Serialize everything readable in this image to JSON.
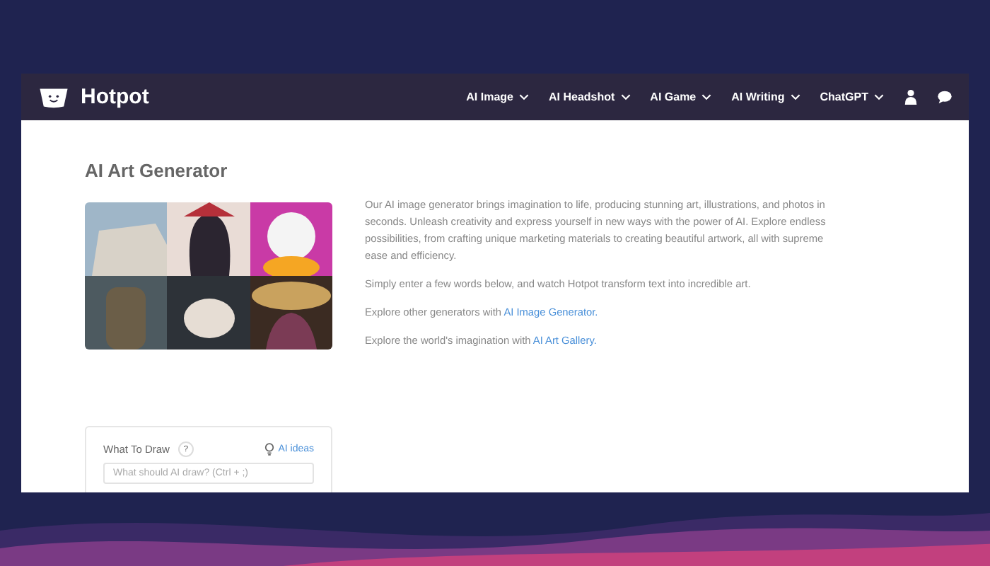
{
  "header": {
    "brand": "Hotpot",
    "nav": [
      {
        "label": "AI Image"
      },
      {
        "label": "AI Headshot"
      },
      {
        "label": "AI Game"
      },
      {
        "label": "AI Writing"
      },
      {
        "label": "ChatGPT"
      }
    ]
  },
  "page": {
    "title": "AI Art Generator",
    "intro": "Our AI image generator brings imagination to life, producing stunning art, illustrations, and photos in seconds. Unleash creativity and express yourself in new ways with the power of AI. Explore endless possibilities, from crafting unique marketing materials to creating beautiful artwork, all with supreme ease and efficiency.",
    "paragraphs": [
      {
        "text": "Simply enter a few words below, and watch Hotpot transform text into incredible art."
      },
      {
        "text": "Explore other generators with ",
        "link": "AI Image Generator."
      },
      {
        "text": "Explore the world's imagination with ",
        "link": "AI Art Gallery."
      }
    ]
  },
  "form": {
    "label": "What To Draw",
    "help": "?",
    "ideas": "AI ideas",
    "placeholder": "What should AI draw? (Ctrl + ;)"
  }
}
